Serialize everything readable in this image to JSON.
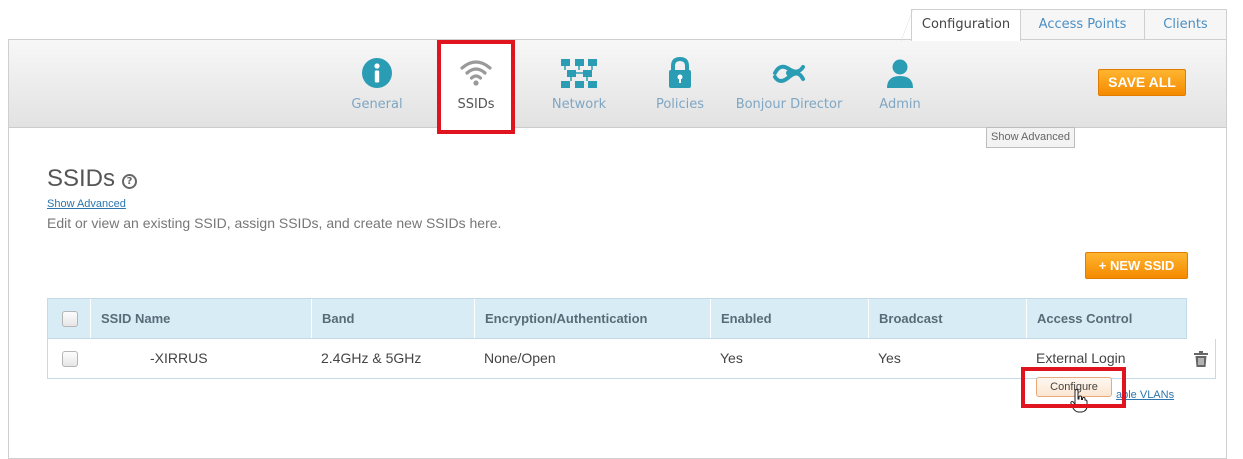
{
  "top_tabs": [
    {
      "label": "Configuration",
      "active": true
    },
    {
      "label": "Access Points",
      "active": false
    },
    {
      "label": "Clients",
      "active": false
    }
  ],
  "nav": [
    {
      "label": "General",
      "icon": "info-icon",
      "active": false
    },
    {
      "label": "SSIDs",
      "icon": "wifi-icon",
      "active": true
    },
    {
      "label": "Network",
      "icon": "network-icon",
      "active": false
    },
    {
      "label": "Policies",
      "icon": "lock-icon",
      "active": false
    },
    {
      "label": "Bonjour Director",
      "icon": "bonjour-icon",
      "active": false
    },
    {
      "label": "Admin",
      "icon": "user-icon",
      "active": false
    }
  ],
  "save_all": "SAVE ALL",
  "show_advanced_button": "Show Advanced",
  "page": {
    "title": "SSIDs",
    "help": "?",
    "show_advanced_link": "Show Advanced",
    "description": "Edit or view an existing SSID, assign SSIDs, and create new SSIDs here."
  },
  "new_ssid": "+ NEW SSID",
  "table": {
    "headers": [
      "SSID Name",
      "Band",
      "Encryption/Authentication",
      "Enabled",
      "Broadcast",
      "Access Control"
    ],
    "rows": [
      [
        "-XIRRUS",
        "2.4GHz & 5GHz",
        "None/Open",
        "Yes",
        "Yes",
        "External Login"
      ]
    ]
  },
  "configure": "Configure",
  "enable_vlans": "able VLANs",
  "colors": {
    "accent_orange": "#f58a00",
    "highlight_red": "#e0141e",
    "header_blue": "#d8ecf6",
    "link_blue": "#2d76ad",
    "icon_teal": "#2a9db5"
  }
}
